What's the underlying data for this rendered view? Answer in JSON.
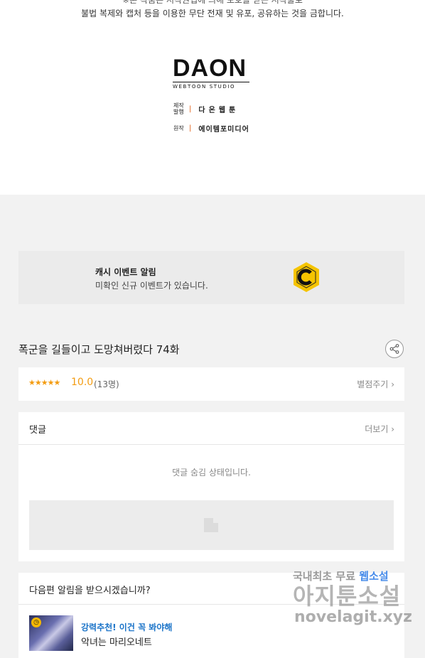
{
  "notice": {
    "line1": "※본 작품은 저작권법에 의해 보호를 받는 저작물로",
    "line2": "불법 복제와 캡처 등을 이용한 무단 전재 및 유포, 공유하는 것을 금합니다."
  },
  "logo": {
    "word": "DAON",
    "sub": "WEBTOON STUDIO"
  },
  "credits": [
    {
      "key": "제작 발행",
      "value": "다온웹툰"
    },
    {
      "key": "원작",
      "value": "에이템포미디어"
    }
  ],
  "cash_event": {
    "title": "캐시 이벤트 알림",
    "description": "미확인 신규 이벤트가 있습니다.",
    "icon": "cash-coin-icon",
    "coin_color": "#f5c400"
  },
  "episode": {
    "title": "폭군을 길들이고 도망쳐버렸다 74화",
    "share_icon": "share-icon"
  },
  "rating": {
    "stars": "★★★★★",
    "score": "10.0",
    "count": "(13명)",
    "rate_button": "별점주기",
    "accent": "#f39c12"
  },
  "comments": {
    "title": "댓글",
    "more": "더보기",
    "hidden_message": "댓글 숨김 상태입니다."
  },
  "next_alert": {
    "title": "다음편 알림을 받으시겠습니까?",
    "recommend_label": "강력추천! 이건 꼭 봐야해",
    "recommend_title": "악녀는 마리오네트",
    "accent": "#1a73c8"
  },
  "watermark": {
    "line1_a": "국내최초 무료",
    "line1_b": "웹소설",
    "line2": "아지툰소설",
    "line3": "novelagit.xyz"
  }
}
